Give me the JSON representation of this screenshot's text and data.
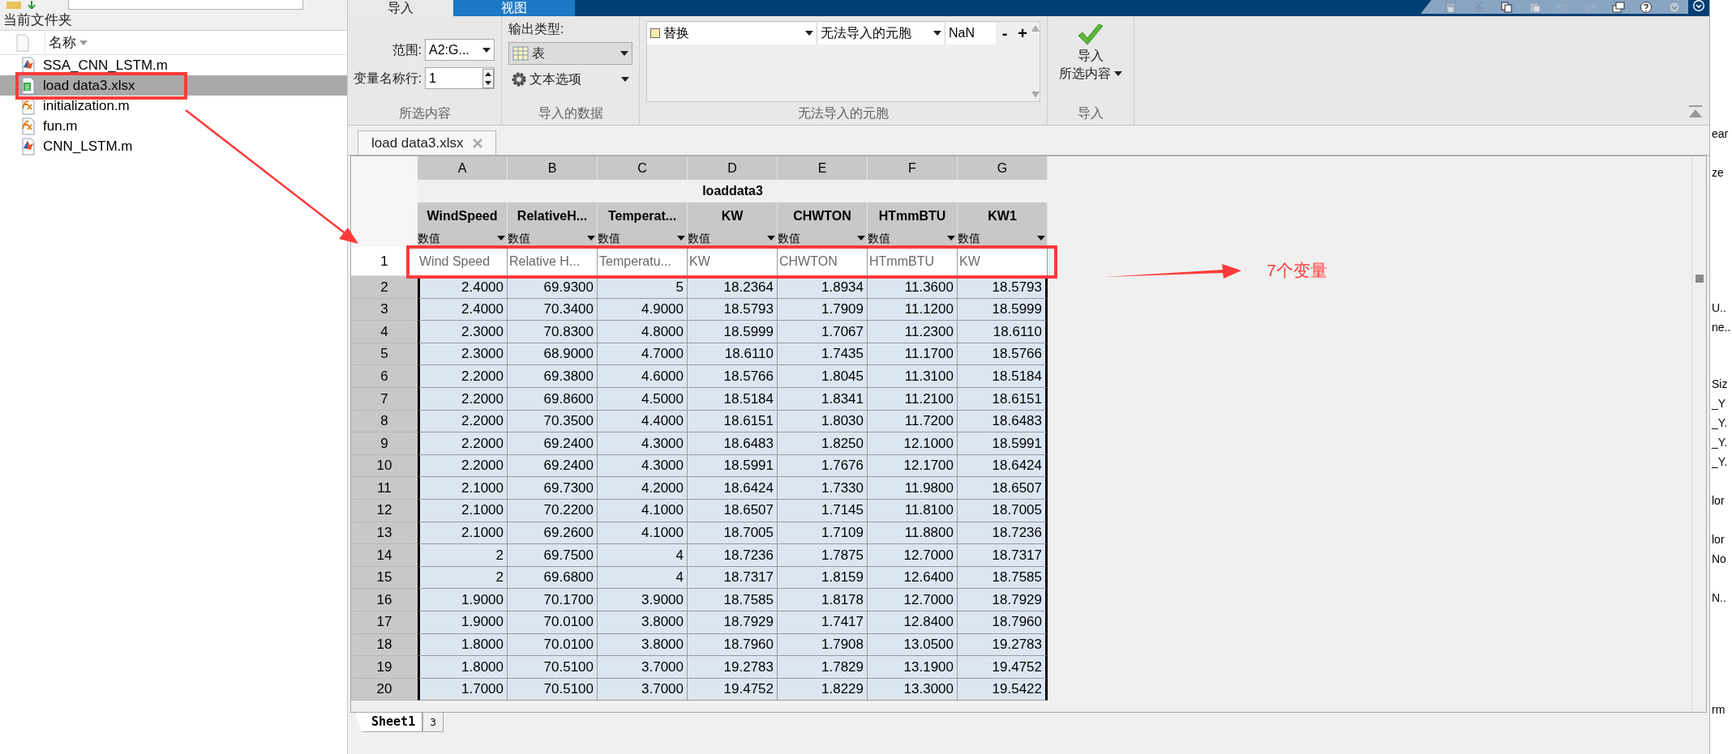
{
  "file_browser": {
    "title": "当前文件夹",
    "name_column": "名称",
    "files": [
      {
        "name": "SSA_CNN_LSTM.m",
        "kind": "script",
        "selected": false
      },
      {
        "name": "load data3.xlsx",
        "kind": "spreadsheet",
        "selected": true
      },
      {
        "name": "initialization.m",
        "kind": "function",
        "selected": false
      },
      {
        "name": "fun.m",
        "kind": "function",
        "selected": false
      },
      {
        "name": "CNN_LSTM.m",
        "kind": "script",
        "selected": false
      }
    ]
  },
  "import_window": {
    "tabs": [
      {
        "label": "导入",
        "selected": true
      },
      {
        "label": "视图",
        "selected": false
      }
    ],
    "selection_section": {
      "title": "所选内容",
      "range_label": "范围:",
      "range_value": "A2:G...",
      "name_row_label": "变量名称行:",
      "name_row_value": "1"
    },
    "data_section": {
      "title": "导入的数据",
      "output_type_label": "输出类型:",
      "output_type": "表",
      "text_options": "文本选项"
    },
    "unimportable_section": {
      "title": "无法导入的元胞",
      "rules": [
        {
          "action": "替换",
          "target": "无法导入的元胞",
          "value": "NaN"
        }
      ],
      "remove_label": "-",
      "add_label": "+"
    },
    "import_section": {
      "title": "导入",
      "button_lines": [
        "导入",
        "所选内容"
      ]
    },
    "document_tab": "load data3.xlsx",
    "grid": {
      "column_letters": [
        "A",
        "B",
        "C",
        "D",
        "E",
        "F",
        "G"
      ],
      "table_name": "loaddata3",
      "variable_names": [
        "WindSpeed",
        "RelativeH...",
        "Temperat...",
        "KW",
        "CHWTON",
        "HTmmBTU",
        "KW1"
      ],
      "variable_types": [
        "数值",
        "数值",
        "数值",
        "数值",
        "数值",
        "数值",
        "数值"
      ],
      "rows": [
        {
          "number": "1",
          "selected": false,
          "cells": [
            "Wind Speed",
            "Relative H...",
            "Temperatu...",
            "KW",
            "CHWTON",
            "HTmmBTU",
            "KW"
          ]
        },
        {
          "number": "2",
          "selected": true,
          "cells": [
            "2.4000",
            "69.9300",
            "5",
            "18.2364",
            "1.8934",
            "11.3600",
            "18.5793"
          ]
        },
        {
          "number": "3",
          "selected": true,
          "cells": [
            "2.4000",
            "70.3400",
            "4.9000",
            "18.5793",
            "1.7909",
            "11.1200",
            "18.5999"
          ]
        },
        {
          "number": "4",
          "selected": true,
          "cells": [
            "2.3000",
            "70.8300",
            "4.8000",
            "18.5999",
            "1.7067",
            "11.2300",
            "18.6110"
          ]
        },
        {
          "number": "5",
          "selected": true,
          "cells": [
            "2.3000",
            "68.9000",
            "4.7000",
            "18.6110",
            "1.7435",
            "11.1700",
            "18.5766"
          ]
        },
        {
          "number": "6",
          "selected": true,
          "cells": [
            "2.2000",
            "69.3800",
            "4.6000",
            "18.5766",
            "1.8045",
            "11.3100",
            "18.5184"
          ]
        },
        {
          "number": "7",
          "selected": true,
          "cells": [
            "2.2000",
            "69.8600",
            "4.5000",
            "18.5184",
            "1.8341",
            "11.2100",
            "18.6151"
          ]
        },
        {
          "number": "8",
          "selected": true,
          "cells": [
            "2.2000",
            "70.3500",
            "4.4000",
            "18.6151",
            "1.8030",
            "11.7200",
            "18.6483"
          ]
        },
        {
          "number": "9",
          "selected": true,
          "cells": [
            "2.2000",
            "69.2400",
            "4.3000",
            "18.6483",
            "1.8250",
            "12.1000",
            "18.5991"
          ]
        },
        {
          "number": "10",
          "selected": true,
          "cells": [
            "2.2000",
            "69.2400",
            "4.3000",
            "18.5991",
            "1.7676",
            "12.1700",
            "18.6424"
          ]
        },
        {
          "number": "11",
          "selected": true,
          "cells": [
            "2.1000",
            "69.7300",
            "4.2000",
            "18.6424",
            "1.7330",
            "11.9800",
            "18.6507"
          ]
        },
        {
          "number": "12",
          "selected": true,
          "cells": [
            "2.1000",
            "70.2200",
            "4.1000",
            "18.6507",
            "1.7145",
            "11.8100",
            "18.7005"
          ]
        },
        {
          "number": "13",
          "selected": true,
          "cells": [
            "2.1000",
            "69.2600",
            "4.1000",
            "18.7005",
            "1.7109",
            "11.8800",
            "18.7236"
          ]
        },
        {
          "number": "14",
          "selected": true,
          "cells": [
            "2",
            "69.7500",
            "4",
            "18.7236",
            "1.7875",
            "12.7000",
            "18.7317"
          ]
        },
        {
          "number": "15",
          "selected": true,
          "cells": [
            "2",
            "69.6800",
            "4",
            "18.7317",
            "1.8159",
            "12.6400",
            "18.7585"
          ]
        },
        {
          "number": "16",
          "selected": true,
          "cells": [
            "1.9000",
            "70.1700",
            "3.9000",
            "18.7585",
            "1.8178",
            "12.7000",
            "18.7929"
          ]
        },
        {
          "number": "17",
          "selected": true,
          "cells": [
            "1.9000",
            "70.0100",
            "3.8000",
            "18.7929",
            "1.7417",
            "12.8400",
            "18.7960"
          ]
        },
        {
          "number": "18",
          "selected": true,
          "cells": [
            "1.8000",
            "70.0100",
            "3.8000",
            "18.7960",
            "1.7908",
            "13.0500",
            "19.2783"
          ]
        },
        {
          "number": "19",
          "selected": true,
          "cells": [
            "1.8000",
            "70.5100",
            "3.7000",
            "19.2783",
            "1.7829",
            "13.1900",
            "19.4752"
          ]
        },
        {
          "number": "20",
          "selected": true,
          "cells": [
            "1.7000",
            "70.5100",
            "3.7000",
            "19.4752",
            "1.8229",
            "13.3000",
            "19.5422"
          ]
        }
      ]
    },
    "sheet_tabs": [
      {
        "label": "Sheet1",
        "selected": true
      },
      {
        "label": "3",
        "selected": false
      }
    ]
  },
  "workspace_fragments": [
    "ear",
    "ze",
    "U..",
    "ne..",
    "Siz",
    "_Y",
    "_Y.",
    "_Y.",
    "_Y.",
    "lor",
    "lor",
    "No",
    "N..",
    "rm"
  ],
  "annotation_note": "7个变量"
}
